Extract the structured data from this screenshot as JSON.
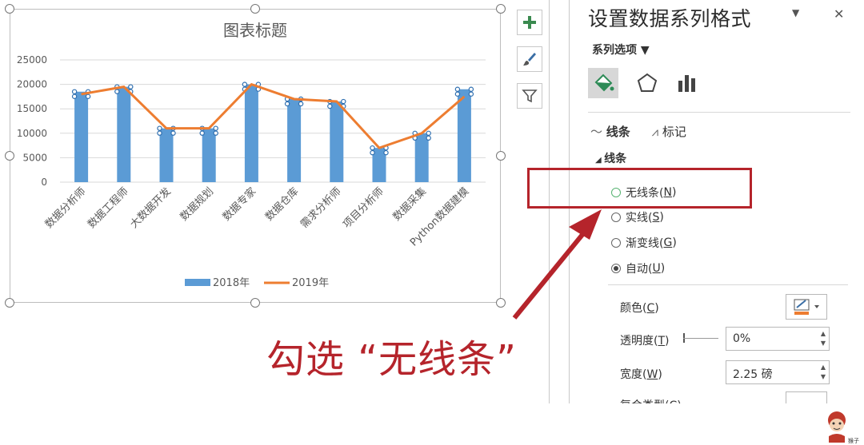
{
  "chart": {
    "title": "图表标题",
    "legend": [
      {
        "label": "2018年",
        "color": "#5b9bd5",
        "kind": "bar"
      },
      {
        "label": "2019年",
        "color": "#ed7d31",
        "kind": "line"
      }
    ]
  },
  "chart_data": {
    "type": "bar",
    "title": "图表标题",
    "categories": [
      "数据分析师",
      "数据工程师",
      "大数据开发",
      "数据规划",
      "数据专家",
      "数据仓库",
      "需求分析师",
      "项目分析师",
      "数据采集",
      "Python数据建模"
    ],
    "series": [
      {
        "name": "2018年",
        "type": "bar",
        "color": "#5b9bd5",
        "values": [
          18500,
          19500,
          11000,
          11000,
          20000,
          17000,
          16500,
          7000,
          10000,
          19000
        ]
      },
      {
        "name": "2019年",
        "type": "line",
        "color": "#ed7d31",
        "values": [
          18000,
          19500,
          11000,
          11000,
          20000,
          17000,
          16500,
          7000,
          10000,
          17500
        ]
      }
    ],
    "yticks": [
      0,
      5000,
      10000,
      15000,
      20000,
      25000
    ],
    "ylim": [
      0,
      25000
    ],
    "grid": true,
    "legend_position": "bottom"
  },
  "side_tools": [
    {
      "name": "plus-icon",
      "label": "+"
    },
    {
      "name": "brush-icon",
      "label": ""
    },
    {
      "name": "filter-icon",
      "label": ""
    }
  ],
  "panel": {
    "title": "设置数据系列格式",
    "dropdown_glyph": "▼",
    "close_glyph": "✕",
    "series_options": "系列选项 ▼",
    "subtab_line": "线条",
    "subtab_marker": "标记",
    "section": "线条",
    "radios": [
      {
        "pre": "无线条(",
        "key": "N",
        "post": ")",
        "checked": false,
        "highlight": true
      },
      {
        "pre": "实线(",
        "key": "S",
        "post": ")",
        "checked": false,
        "highlight": false
      },
      {
        "pre": "渐变线(",
        "key": "G",
        "post": ")",
        "checked": false,
        "highlight": false
      },
      {
        "pre": "自动(",
        "key": "U",
        "post": ")",
        "checked": true,
        "highlight": false
      }
    ],
    "color": {
      "pre": "颜色(",
      "key": "C",
      "post": ")"
    },
    "transparency": {
      "pre": "透明度(",
      "key": "T",
      "post": ")",
      "value": "0%"
    },
    "width": {
      "pre": "宽度(",
      "key": "W",
      "post": ")",
      "value": "2.25 磅"
    },
    "compound": "复合类型(C)"
  },
  "callout": "勾选 “无线条”",
  "logo_text": "猴子"
}
